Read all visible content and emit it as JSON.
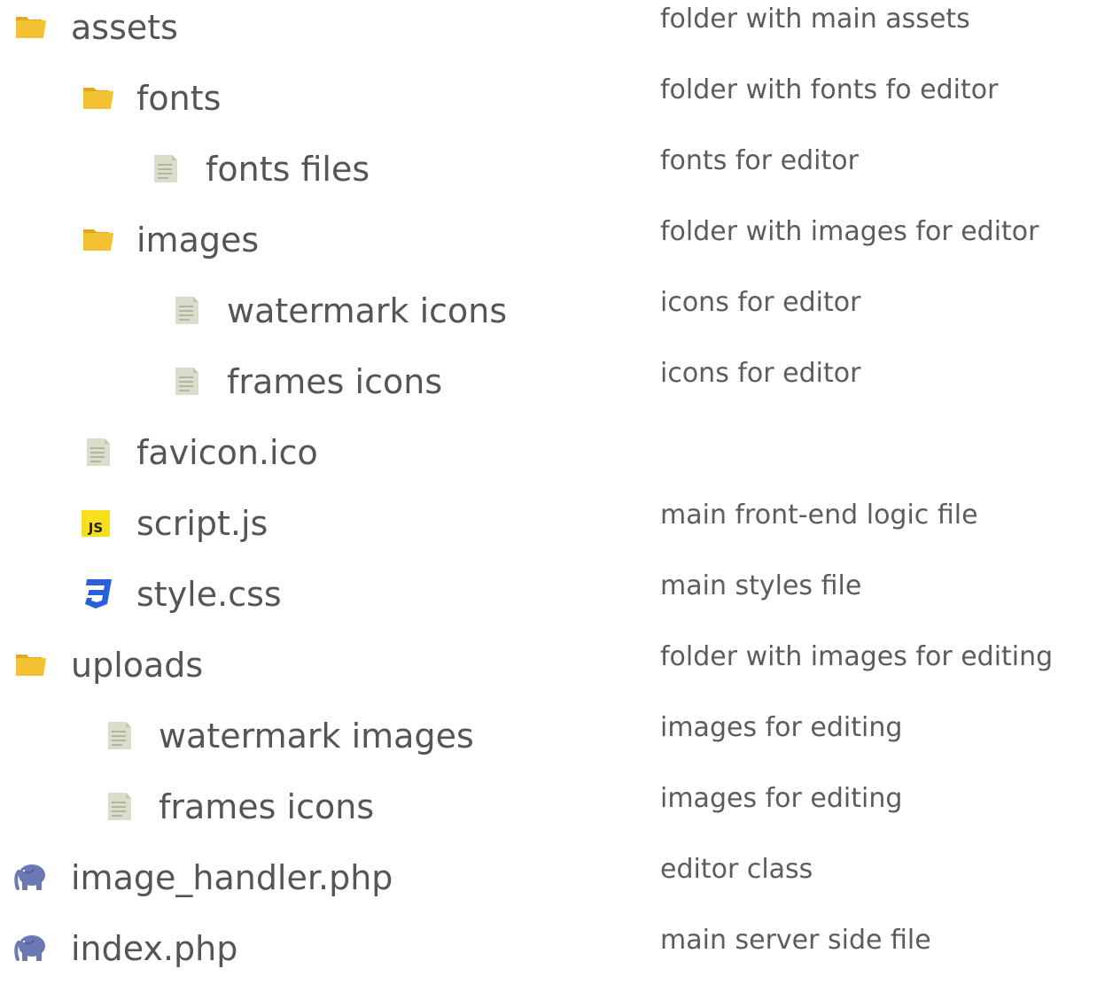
{
  "colors": {
    "folder": "#f3c233",
    "folder_back": "#e0a81e",
    "file": "#dcdccb",
    "js_bg": "#f7df1e",
    "css": "#2a5fdc",
    "php": "#6b78b3",
    "name_text": "#555555",
    "desc_text": "#5c5c5c"
  },
  "items": [
    {
      "icon": "folder-icon",
      "name": "assets",
      "desc": "folder with main assets"
    },
    {
      "icon": "folder-icon",
      "name": "fonts",
      "desc": "folder with fonts fo editor"
    },
    {
      "icon": "file-icon",
      "name": "fonts files",
      "desc": "fonts for editor"
    },
    {
      "icon": "folder-icon",
      "name": "images",
      "desc": "folder with images for editor"
    },
    {
      "icon": "file-icon",
      "name": "watermark icons",
      "desc": "icons for editor"
    },
    {
      "icon": "file-icon",
      "name": "frames icons",
      "desc": "icons for editor"
    },
    {
      "icon": "file-icon",
      "name": "favicon.ico",
      "desc": ""
    },
    {
      "icon": "js-icon",
      "name": "script.js",
      "desc": "main front-end logic file"
    },
    {
      "icon": "css3-icon",
      "name": "style.css",
      "desc": "main styles file"
    },
    {
      "icon": "folder-icon",
      "name": "uploads",
      "desc": "folder with images for editing"
    },
    {
      "icon": "file-icon",
      "name": "watermark images",
      "desc": "images for editing"
    },
    {
      "icon": "file-icon",
      "name": "frames icons",
      "desc": "images for editing"
    },
    {
      "icon": "php-elephant-icon",
      "name": "image_handler.php",
      "desc": "editor class"
    },
    {
      "icon": "php-elephant-icon",
      "name": "index.php",
      "desc": "main server side file"
    }
  ]
}
